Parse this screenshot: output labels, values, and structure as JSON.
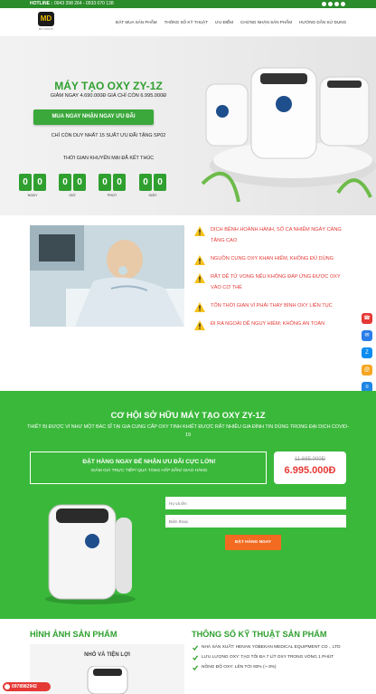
{
  "topbar": {
    "hotline_label": "HOTLINE :",
    "phones": "0943 398 264 - 0933 070 138",
    "social_icons": [
      "facebook-icon",
      "google-plus-icon",
      "twitter-icon",
      "email-icon"
    ]
  },
  "header": {
    "logo_text": "MD",
    "logo_sub": "MD GROUP",
    "nav": [
      "ĐẶT MUA SẢN PHẨM",
      "THÔNG SỐ KỸ THUẬT",
      "ƯU ĐIỂM",
      "CHỨNG NHẬN SẢN PHẨM",
      "HƯỚNG DẪN SỬ DỤNG"
    ]
  },
  "hero": {
    "title": "MÁY TẠO OXY ZY-1Z",
    "price_line": "GIẢM NGAY 4.690.000Đ GIÁ CHỈ CÒN 6.995.000Đ",
    "cta": "MUA NGAY NHẬN NGAY ƯU ĐÃI",
    "stock": "CHỈ CÒN DUY NHẤT 15 SUẤT ƯU ĐÃI TẶNG SP02",
    "timer_label": "THỜI GIAN KHUYẾN MẠI ĐÃ KẾT THÚC",
    "timer": [
      {
        "digits": [
          "0",
          "0"
        ],
        "label": "NGÀY"
      },
      {
        "digits": [
          "0",
          "0"
        ],
        "label": "GIỜ"
      },
      {
        "digits": [
          "0",
          "0"
        ],
        "label": "PHÚT"
      },
      {
        "digits": [
          "0",
          "0"
        ],
        "label": "GIÂY"
      }
    ]
  },
  "problems": [
    "DỊCH BỆNH HOÀNH HÀNH, SỐ CA NHIỄM NGÀY CÀNG TĂNG CAO",
    "NGUỒN CUNG OXY KHAN HIẾM, KHÔNG ĐỦ DÙNG",
    "RẤT DỄ TỬ VONG NẾU KHÔNG ĐÁP ỨNG ĐƯỢC OXY VÀO CƠ THỂ",
    "TỐN THỜI GIAN VÌ PHẢI THAY BÌNH OXY LIÊN TỤC",
    "ĐI RA NGOÀI DỄ NGUY HIỂM; KHÔNG AN TOÀN"
  ],
  "offer": {
    "title": "CƠ HỘI SỞ HỮU MÁY TẠO OXY ZY-1Z",
    "subtitle": "THIẾT BỊ ĐƯỢC VÍ NHƯ MỘT BÁC SĨ TẠI GIA CUNG CẤP OXY TINH KHIẾT ĐƯỢC RẤT NHIỀU GIA ĐÌNH TIN DÙNG TRONG ĐẠI DỊCH COVID-19",
    "box_line1": "ĐẶT HÀNG NGAY ĐỂ NHẬN ƯU ĐÃI CỰC LỚN!",
    "box_line2": "GIẢM GIÁ TRỰC TIẾP/ QUÀ TẶNG HẤP DẪN/ GIAO HÀNG",
    "old_price": "11.685.000Đ",
    "new_price": "6.995.000Đ",
    "name_placeholder": "Họ và tên",
    "phone_placeholder": "Điện thoại",
    "order_button": "ĐẶT HÀNG NGAY"
  },
  "gallery": {
    "title": "HÌNH ẢNH SẢN PHẨM",
    "caption": "NHỎ VÀ TIỆN LỢI"
  },
  "specs": {
    "title": "THÔNG SỐ KỸ THUẬT SẢN PHẨM",
    "items": [
      "NHÀ SẢN XUẤT: HENAN YOBEKAN MEDICAL EQUIPMENT CO ., LTD",
      "LƯU LƯỢNG OXY: TẠO TỐI ĐA 7 LÍT OXY TRONG VÒNG 1 PHÚT",
      "NỒNG ĐỘ OXY: LÊN TỚI 93% (+-3%)"
    ]
  },
  "hotline_pill": "0978982942",
  "side_icons": [
    "phone-icon",
    "messenger-icon",
    "zalo-icon",
    "email-icon",
    "sms-icon"
  ],
  "colors": {
    "primary_green": "#3ab83a",
    "accent_red": "#e53935",
    "button_orange": "#f36b21"
  }
}
